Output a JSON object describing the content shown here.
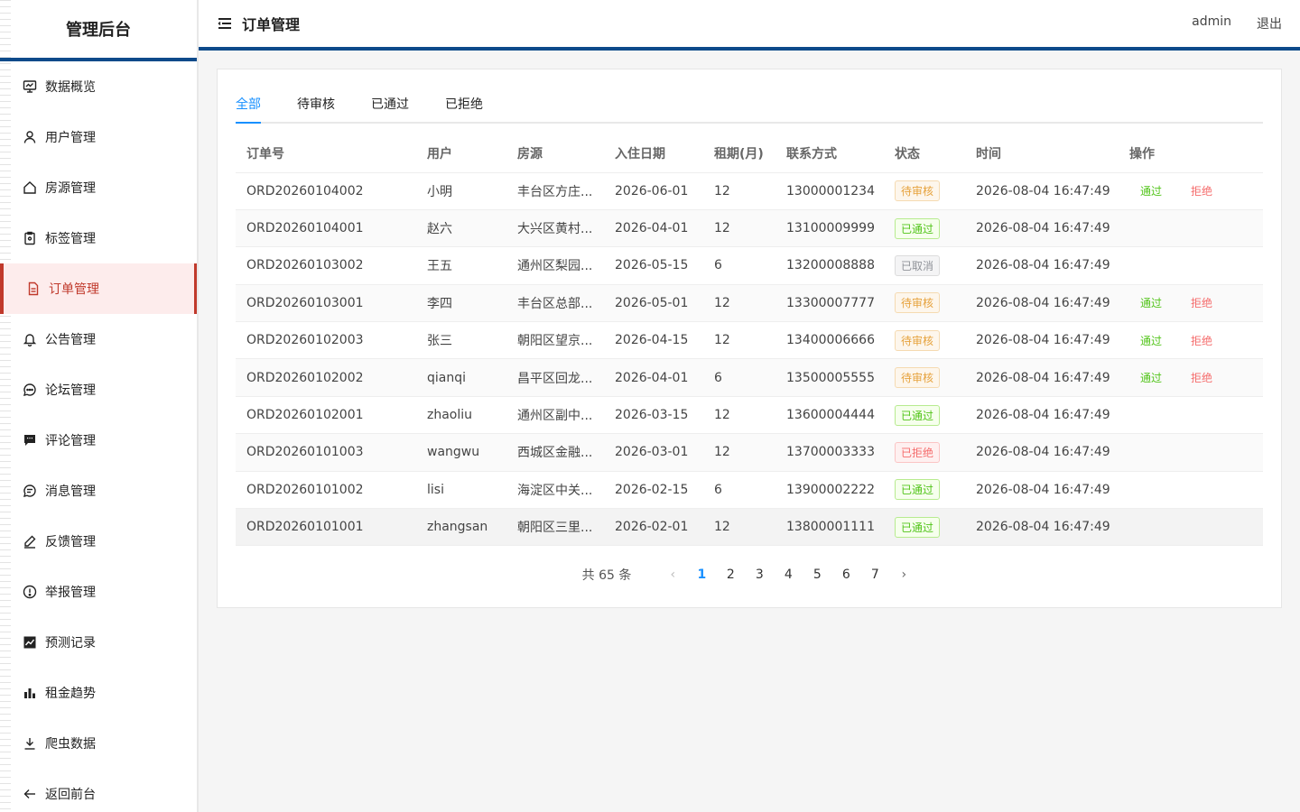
{
  "sidebar": {
    "brand": "管理后台",
    "items": [
      {
        "label": "数据概览",
        "icon": "dashboard-icon"
      },
      {
        "label": "用户管理",
        "icon": "user-icon"
      },
      {
        "label": "房源管理",
        "icon": "home-icon"
      },
      {
        "label": "标签管理",
        "icon": "tag-icon"
      },
      {
        "label": "订单管理",
        "icon": "document-icon",
        "active": true
      },
      {
        "label": "公告管理",
        "icon": "bell-icon"
      },
      {
        "label": "论坛管理",
        "icon": "chat-icon"
      },
      {
        "label": "评论管理",
        "icon": "comment-icon"
      },
      {
        "label": "消息管理",
        "icon": "message-icon"
      },
      {
        "label": "反馈管理",
        "icon": "pen-icon"
      },
      {
        "label": "举报管理",
        "icon": "alert-icon"
      },
      {
        "label": "预测记录",
        "icon": "trend-icon"
      },
      {
        "label": "租金趋势",
        "icon": "bar-chart-icon"
      },
      {
        "label": "爬虫数据",
        "icon": "download-icon"
      },
      {
        "label": "返回前台",
        "icon": "arrow-left-icon"
      }
    ]
  },
  "header": {
    "title": "订单管理",
    "user": "admin",
    "logout": "退出"
  },
  "tabs": [
    "全部",
    "待审核",
    "已通过",
    "已拒绝"
  ],
  "table": {
    "columns": [
      "订单号",
      "用户",
      "房源",
      "入住日期",
      "租期(月)",
      "联系方式",
      "状态",
      "时间",
      "操作"
    ],
    "actions": {
      "pass": "通过",
      "reject": "拒绝"
    },
    "rows": [
      {
        "id": "ORD20260104002",
        "user": "小明",
        "house": "丰台区方庄...",
        "date": "2026-06-01",
        "term": "12",
        "phone": "13000001234",
        "status": "待审核",
        "status_type": "pending",
        "time": "2026-08-04 16:47:49"
      },
      {
        "id": "ORD20260104001",
        "user": "赵六",
        "house": "大兴区黄村...",
        "date": "2026-04-01",
        "term": "12",
        "phone": "13100009999",
        "status": "已通过",
        "status_type": "approved",
        "time": "2026-08-04 16:47:49"
      },
      {
        "id": "ORD20260103002",
        "user": "王五",
        "house": "通州区梨园...",
        "date": "2026-05-15",
        "term": "6",
        "phone": "13200008888",
        "status": "已取消",
        "status_type": "cancelled",
        "time": "2026-08-04 16:47:49"
      },
      {
        "id": "ORD20260103001",
        "user": "李四",
        "house": "丰台区总部...",
        "date": "2026-05-01",
        "term": "12",
        "phone": "13300007777",
        "status": "待审核",
        "status_type": "pending",
        "time": "2026-08-04 16:47:49"
      },
      {
        "id": "ORD20260102003",
        "user": "张三",
        "house": "朝阳区望京...",
        "date": "2026-04-15",
        "term": "12",
        "phone": "13400006666",
        "status": "待审核",
        "status_type": "pending",
        "time": "2026-08-04 16:47:49"
      },
      {
        "id": "ORD20260102002",
        "user": "qianqi",
        "house": "昌平区回龙...",
        "date": "2026-04-01",
        "term": "6",
        "phone": "13500005555",
        "status": "待审核",
        "status_type": "pending",
        "time": "2026-08-04 16:47:49"
      },
      {
        "id": "ORD20260102001",
        "user": "zhaoliu",
        "house": "通州区副中...",
        "date": "2026-03-15",
        "term": "12",
        "phone": "13600004444",
        "status": "已通过",
        "status_type": "approved",
        "time": "2026-08-04 16:47:49"
      },
      {
        "id": "ORD20260101003",
        "user": "wangwu",
        "house": "西城区金融...",
        "date": "2026-03-01",
        "term": "12",
        "phone": "13700003333",
        "status": "已拒绝",
        "status_type": "rejected",
        "time": "2026-08-04 16:47:49"
      },
      {
        "id": "ORD20260101002",
        "user": "lisi",
        "house": "海淀区中关...",
        "date": "2026-02-15",
        "term": "6",
        "phone": "13900002222",
        "status": "已通过",
        "status_type": "approved",
        "time": "2026-08-04 16:47:49"
      },
      {
        "id": "ORD20260101001",
        "user": "zhangsan",
        "house": "朝阳区三里...",
        "date": "2026-02-01",
        "term": "12",
        "phone": "13800001111",
        "status": "已通过",
        "status_type": "approved",
        "time": "2026-08-04 16:47:49"
      }
    ]
  },
  "pagination": {
    "total_text": "共 65 条",
    "pages": [
      "1",
      "2",
      "3",
      "4",
      "5",
      "6",
      "7"
    ],
    "current": "1"
  },
  "colors": {
    "accent": "#1890ff",
    "brand_bar": "#0d4a8a",
    "active_menu": "#c0392b"
  }
}
